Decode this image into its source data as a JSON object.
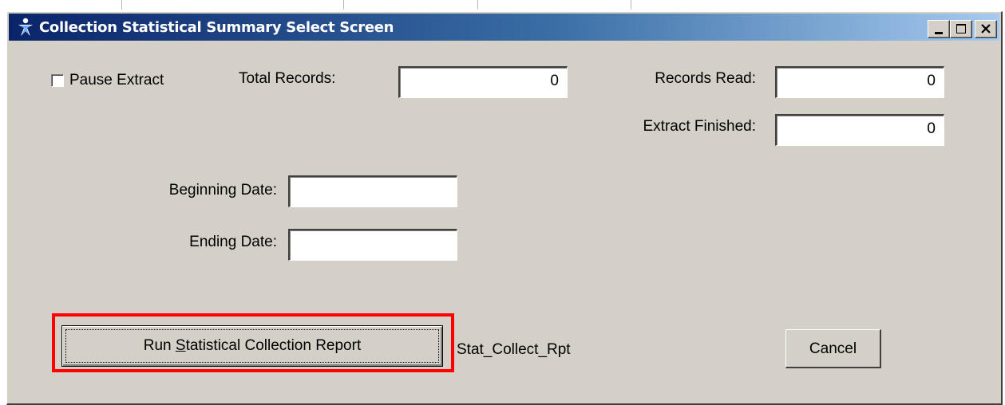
{
  "window": {
    "title": "Collection Statistical Summary Select Screen"
  },
  "form": {
    "pause_extract_label": "Pause Extract",
    "total_records_label": "Total Records:",
    "total_records_value": "0",
    "records_read_label": "Records Read:",
    "records_read_value": "0",
    "extract_finished_label": "Extract Finished:",
    "extract_finished_value": "0",
    "beginning_date_label": "Beginning Date:",
    "beginning_date_value": "",
    "ending_date_label": "Ending Date:",
    "ending_date_value": ""
  },
  "actions": {
    "run_report": {
      "before": "Run ",
      "mnemonic": "S",
      "after": "tatistical Collection Report"
    },
    "report_name": "Stat_Collect_Rpt",
    "cancel_label": "Cancel"
  },
  "colors": {
    "dialog_background": "#d4d0c8",
    "title_gradient_start": "#0a246a",
    "title_gradient_end": "#a6caf0",
    "highlight_border": "#ff0000"
  },
  "icons": {
    "app": "person-star-icon",
    "minimize": "minimize-icon",
    "maximize": "maximize-icon",
    "close": "close-icon"
  }
}
